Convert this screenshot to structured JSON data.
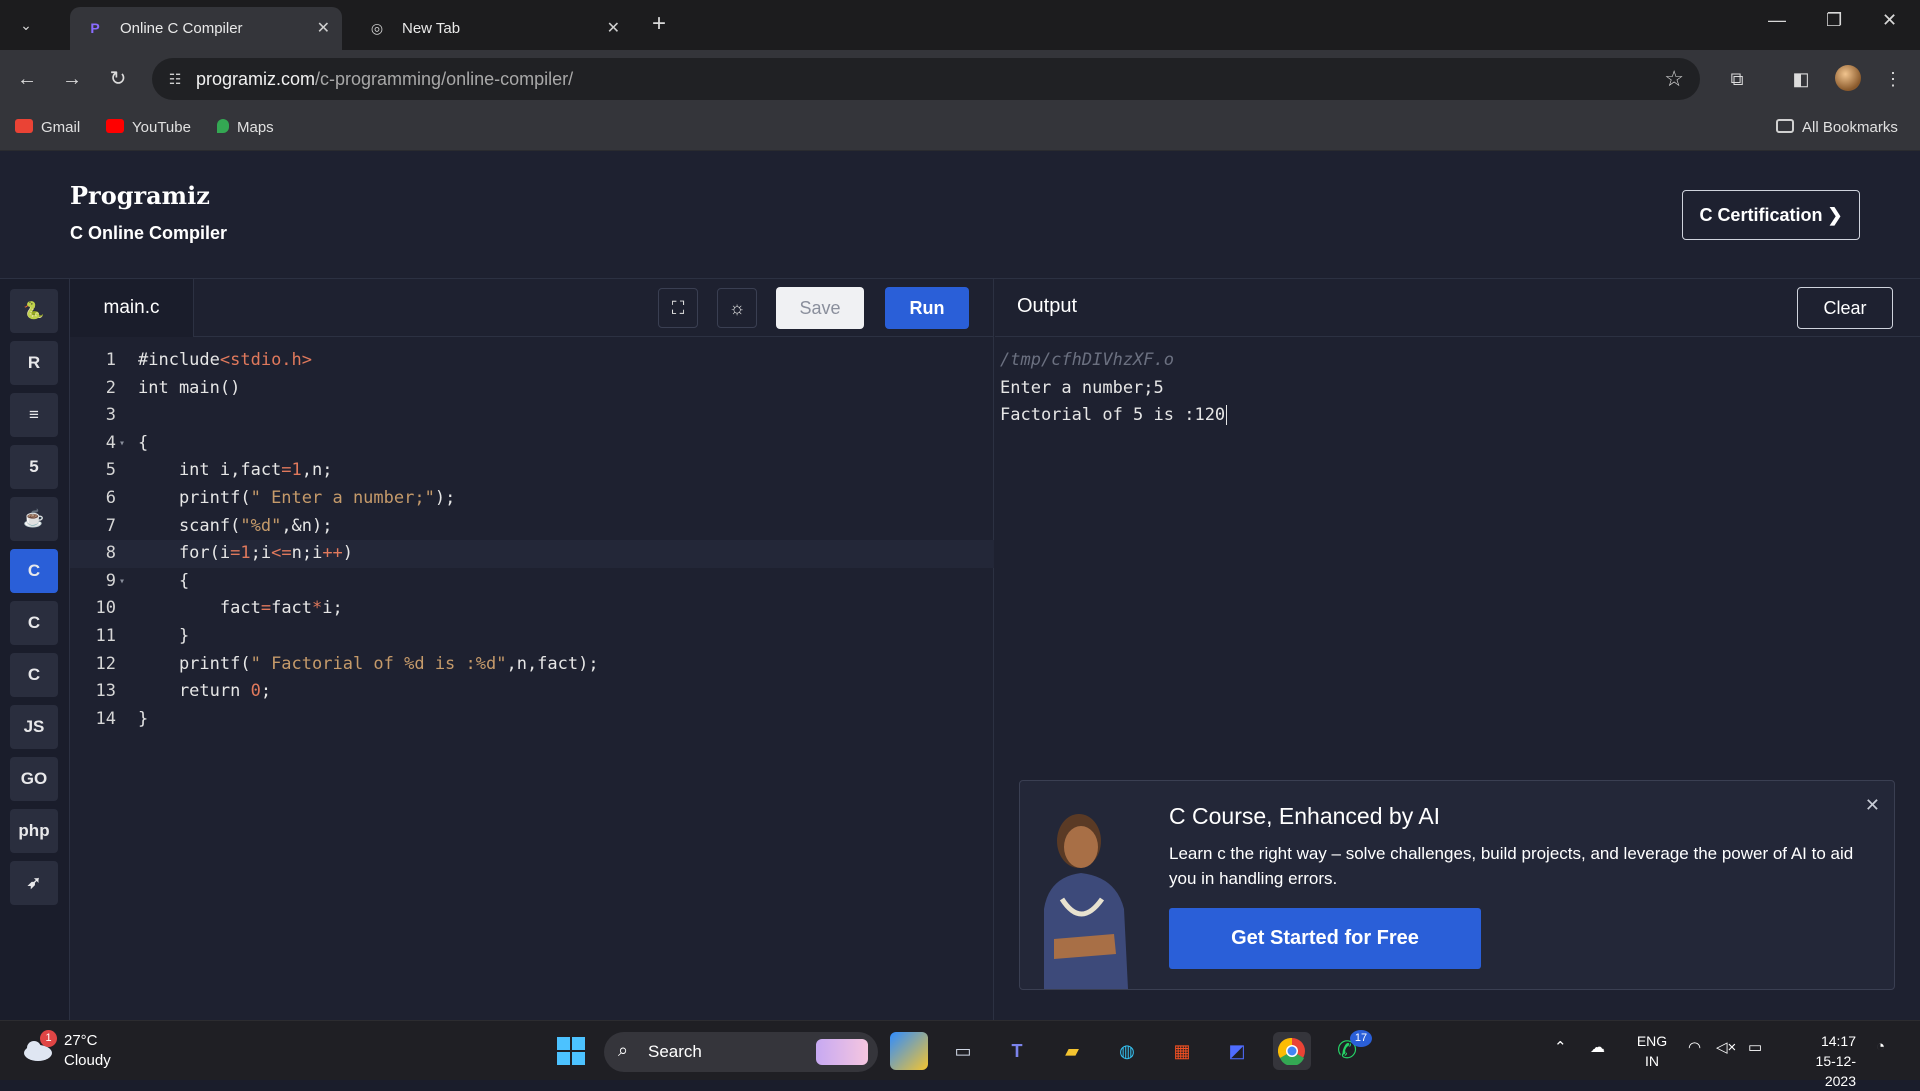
{
  "browser": {
    "tabs": [
      {
        "title": "Online C Compiler",
        "active": true
      },
      {
        "title": "New Tab",
        "active": false
      }
    ],
    "url_host": "programiz.com",
    "url_path": "/c-programming/online-compiler/",
    "bookmarks": [
      {
        "label": "Gmail",
        "color": "#ea4335"
      },
      {
        "label": "YouTube",
        "color": "#ff0000"
      },
      {
        "label": "Maps",
        "color": "#34a853"
      }
    ],
    "all_bookmarks": "All Bookmarks"
  },
  "header": {
    "logo": "Programiz",
    "subtitle": "C Online Compiler",
    "cert_button": "C Certification ❯"
  },
  "sidebar": {
    "languages": [
      {
        "name": "python",
        "glyph": "🐍",
        "active": false
      },
      {
        "name": "r",
        "glyph": "R",
        "active": false
      },
      {
        "name": "sql",
        "glyph": "≡",
        "active": false
      },
      {
        "name": "html",
        "glyph": "5",
        "active": false
      },
      {
        "name": "java",
        "glyph": "☕",
        "active": false
      },
      {
        "name": "c",
        "glyph": "C",
        "active": true
      },
      {
        "name": "cpp",
        "glyph": "C",
        "active": false
      },
      {
        "name": "csharp",
        "glyph": "C",
        "active": false
      },
      {
        "name": "javascript",
        "glyph": "JS",
        "active": false
      },
      {
        "name": "go",
        "glyph": "GO",
        "active": false
      },
      {
        "name": "php",
        "glyph": "php",
        "active": false
      },
      {
        "name": "swift",
        "glyph": "➶",
        "active": false
      }
    ]
  },
  "editor": {
    "filename": "main.c",
    "save_label": "Save",
    "run_label": "Run",
    "lines": [
      "#include<stdio.h>",
      "int main()",
      "",
      "{",
      "    int i,fact=1,n;",
      "    printf(\" Enter a number;\");",
      "    scanf(\"%d\",&n);",
      "    for(i=1;i<=n;i++)",
      "    {",
      "        fact=fact*i;",
      "    }",
      "    printf(\" Factorial of %d is :%d\",n,fact);",
      "    return 0;",
      "}"
    ]
  },
  "output": {
    "title": "Output",
    "clear_label": "Clear",
    "path": "/tmp/cfhDIVhzXF.o",
    "lines": [
      "Enter a number;5",
      "Factorial of 5 is :120"
    ]
  },
  "promo": {
    "title": "C Course, Enhanced by AI",
    "text": "Learn c the right way – solve challenges, build projects, and leverage the power of AI to aid you in handling errors.",
    "cta": "Get Started for Free"
  },
  "taskbar": {
    "temperature": "27°C",
    "condition": "Cloudy",
    "weather_badge": "1",
    "search": "Search",
    "whatsapp_badge": "17",
    "lang_line1": "ENG",
    "lang_line2": "IN",
    "time": "14:17",
    "date": "15-12-2023"
  }
}
